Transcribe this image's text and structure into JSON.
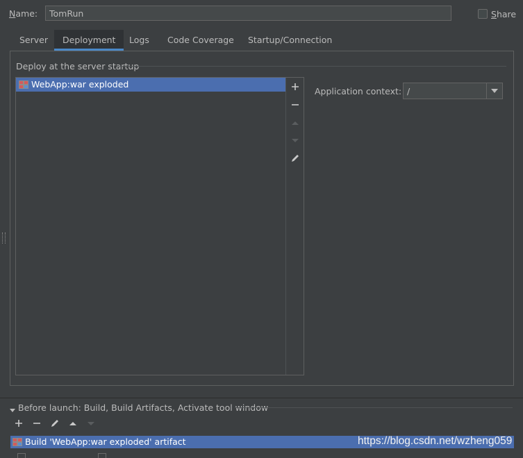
{
  "name_field": {
    "label": "Name:",
    "value": "TomRun"
  },
  "share": {
    "label": "Share",
    "checked": false
  },
  "tabs": [
    {
      "label": "Server",
      "active": false
    },
    {
      "label": "Deployment",
      "active": true
    },
    {
      "label": "Logs",
      "active": false
    },
    {
      "label": "Code Coverage",
      "active": false
    },
    {
      "label": "Startup/Connection",
      "active": false
    }
  ],
  "deployment": {
    "group_title": "Deploy at the server startup",
    "artifacts": [
      "WebApp:war exploded"
    ],
    "toolbar_icons": [
      "plus-icon",
      "minus-icon",
      "arrow-up-icon",
      "arrow-down-icon",
      "pencil-icon"
    ],
    "application_context": {
      "label": "Application context:",
      "value": "/"
    }
  },
  "before_launch": {
    "title": "Before launch: Build, Build Artifacts, Activate tool window",
    "toolbar_icons": [
      "plus-icon",
      "minus-icon",
      "pencil-icon",
      "arrow-up-icon",
      "arrow-down-icon"
    ],
    "tasks": [
      "Build 'WebApp:war exploded' artifact"
    ]
  },
  "watermark": "https://blog.csdn.net/wzheng059",
  "colors": {
    "background": "#3c3f41",
    "selection": "#4b6eaf",
    "tab_underline": "#4a88c7",
    "text": "#bbbbbb"
  }
}
